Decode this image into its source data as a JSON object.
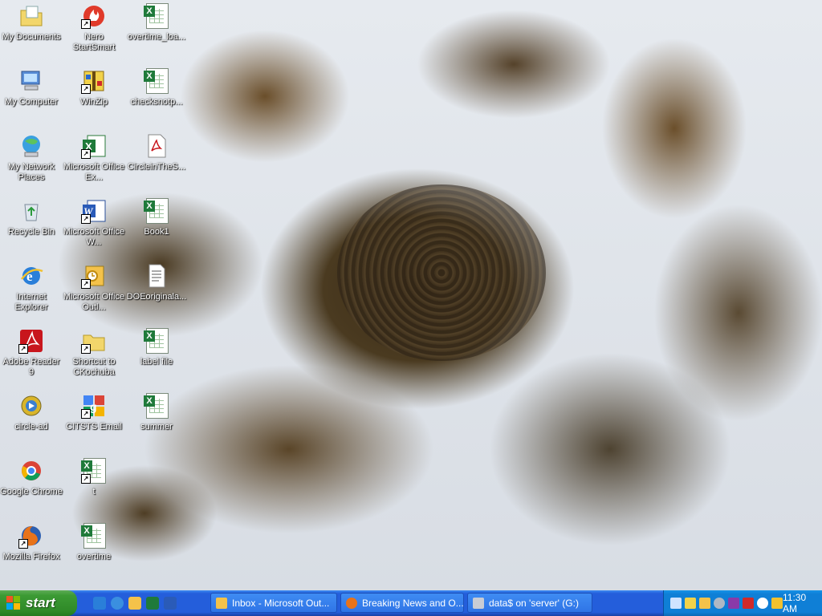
{
  "desktop": {
    "icons": [
      {
        "label": "My Documents",
        "icon": "folder-documents-icon"
      },
      {
        "label": "Nero StartSmart",
        "icon": "nero-icon"
      },
      {
        "label": "overtime_loa...",
        "icon": "excel-file-icon"
      },
      {
        "label": "My Computer",
        "icon": "computer-icon"
      },
      {
        "label": "WinZip",
        "icon": "winzip-icon"
      },
      {
        "label": "checksnotp...",
        "icon": "excel-file-icon"
      },
      {
        "label": "My Network Places",
        "icon": "network-icon"
      },
      {
        "label": "Microsoft Office Ex...",
        "icon": "excel-icon"
      },
      {
        "label": "CircleinTheS...",
        "icon": "pdf-file-icon"
      },
      {
        "label": "Recycle Bin",
        "icon": "recycle-bin-icon"
      },
      {
        "label": "Microsoft Office W...",
        "icon": "word-icon"
      },
      {
        "label": "Book1",
        "icon": "excel-file-icon"
      },
      {
        "label": "Internet Explorer",
        "icon": "internet-explorer-icon"
      },
      {
        "label": "Microsoft Office Outl...",
        "icon": "outlook-icon"
      },
      {
        "label": "DOEoriginala...",
        "icon": "text-file-icon"
      },
      {
        "label": "Adobe Reader 9",
        "icon": "adobe-reader-icon"
      },
      {
        "label": "Shortcut to CKochuba",
        "icon": "folder-icon"
      },
      {
        "label": "label file",
        "icon": "excel-file-icon"
      },
      {
        "label": "circle-ad",
        "icon": "media-file-icon"
      },
      {
        "label": "CITSTS Email",
        "icon": "email-icon"
      },
      {
        "label": "summer",
        "icon": "excel-file-icon"
      },
      {
        "label": "Google Chrome",
        "icon": "chrome-icon"
      },
      {
        "label": "t",
        "icon": "excel-file-icon"
      },
      {
        "label": "Mozilla Firefox",
        "icon": "firefox-icon"
      },
      {
        "label": "overtime",
        "icon": "excel-file-icon"
      }
    ]
  },
  "taskbar": {
    "start_label": "start",
    "quick_launch": [
      "ie-icon",
      "ie-icon",
      "outlook-icon",
      "excel-icon",
      "word-icon"
    ],
    "tasks": [
      {
        "label": "Inbox - Microsoft Out...",
        "icon": "outlook-icon"
      },
      {
        "label": "Breaking News and O...",
        "icon": "firefox-icon"
      },
      {
        "label": "data$ on 'server' (G:)",
        "icon": "drive-icon"
      }
    ],
    "tray_icons": [
      "network-icon",
      "display-icon",
      "outlook-icon",
      "audio-icon",
      "usb-icon",
      "media-icon",
      "clock-icon",
      "security-icon"
    ],
    "clock": "11:30 AM"
  },
  "colors": {
    "taskbar_blue": "#245edb",
    "start_green": "#3c9a34",
    "tray_blue": "#0f7fd6"
  }
}
